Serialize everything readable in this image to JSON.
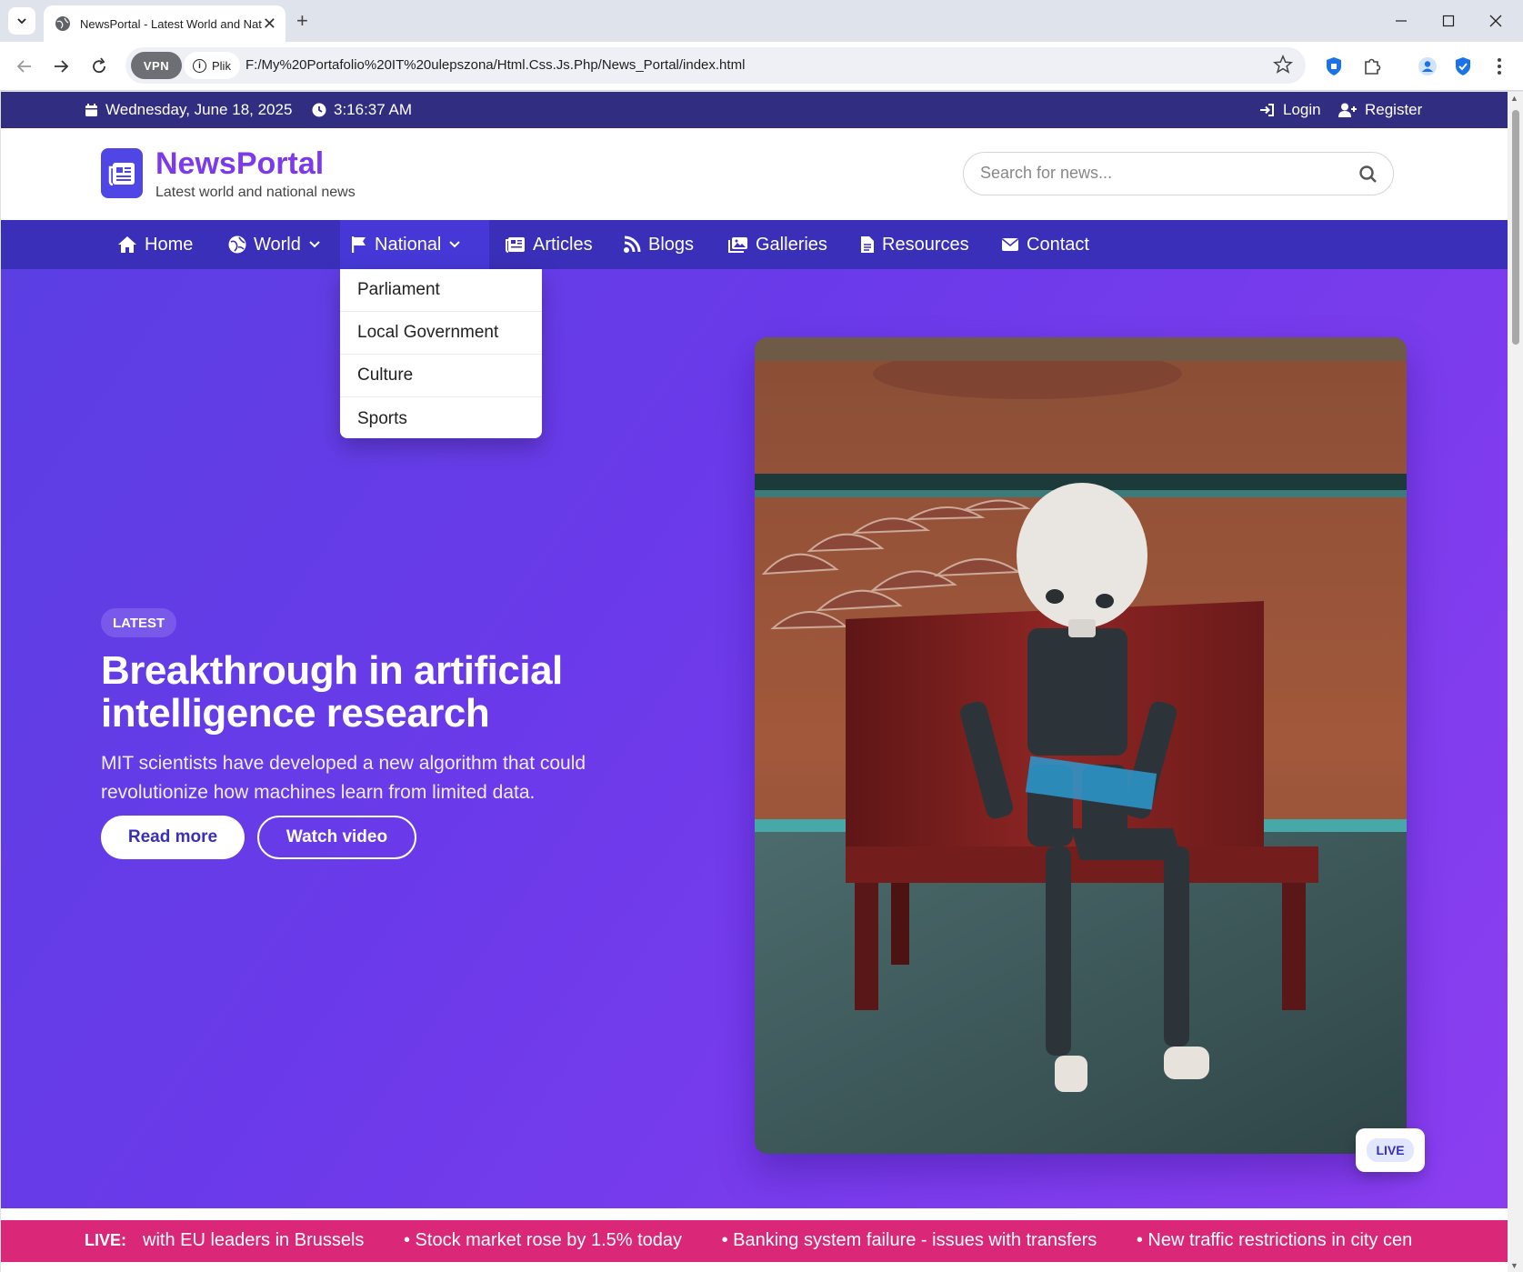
{
  "browser": {
    "tab_title": "NewsPortal - Latest World and Nat",
    "new_tab_symbol": "+",
    "vpn_label": "VPN",
    "site_info_label": "Plik",
    "url": "F:/My%20Portafolio%20IT%20ulepszona/Html.Css.Js.Php/News_Portal/index.html"
  },
  "topbar": {
    "date": "Wednesday, June 18, 2025",
    "time": "3:16:37 AM",
    "login": "Login",
    "register": "Register"
  },
  "header": {
    "brand": "NewsPortal",
    "tagline": "Latest world and national news",
    "search_placeholder": "Search for news..."
  },
  "nav": {
    "items": [
      {
        "label": "Home",
        "icon": "home-icon"
      },
      {
        "label": "World",
        "icon": "globe-icon",
        "dropdown": true
      },
      {
        "label": "National",
        "icon": "flag-icon",
        "dropdown": true,
        "active": true
      },
      {
        "label": "Articles",
        "icon": "newspaper-icon"
      },
      {
        "label": "Blogs",
        "icon": "blog-icon"
      },
      {
        "label": "Galleries",
        "icon": "images-icon"
      },
      {
        "label": "Resources",
        "icon": "file-icon"
      },
      {
        "label": "Contact",
        "icon": "envelope-icon"
      }
    ],
    "national_dropdown": [
      "Parliament",
      "Local Government",
      "Culture",
      "Sports"
    ]
  },
  "hero": {
    "badge": "LATEST",
    "title": "Breakthrough in artificial intelligence research",
    "text": "MIT scientists have developed a new algorithm that could revolutionize how machines learn from limited data.",
    "read_more": "Read more",
    "watch_video": "Watch video",
    "image_badge": "LIVE"
  },
  "ticker": {
    "label": "LIVE:",
    "items": [
      "with EU leaders in Brussels",
      "• Stock market rose by 1.5% today",
      "• Banking system failure - issues with transfers",
      "• New traffic restrictions in city cen"
    ]
  },
  "colors": {
    "topbar": "#312e81",
    "nav": "#3a2fb8",
    "brand": "#7c3aed",
    "hero_start": "#5b3fe3",
    "hero_end": "#8b3ef0",
    "ticker": "#db2777"
  }
}
